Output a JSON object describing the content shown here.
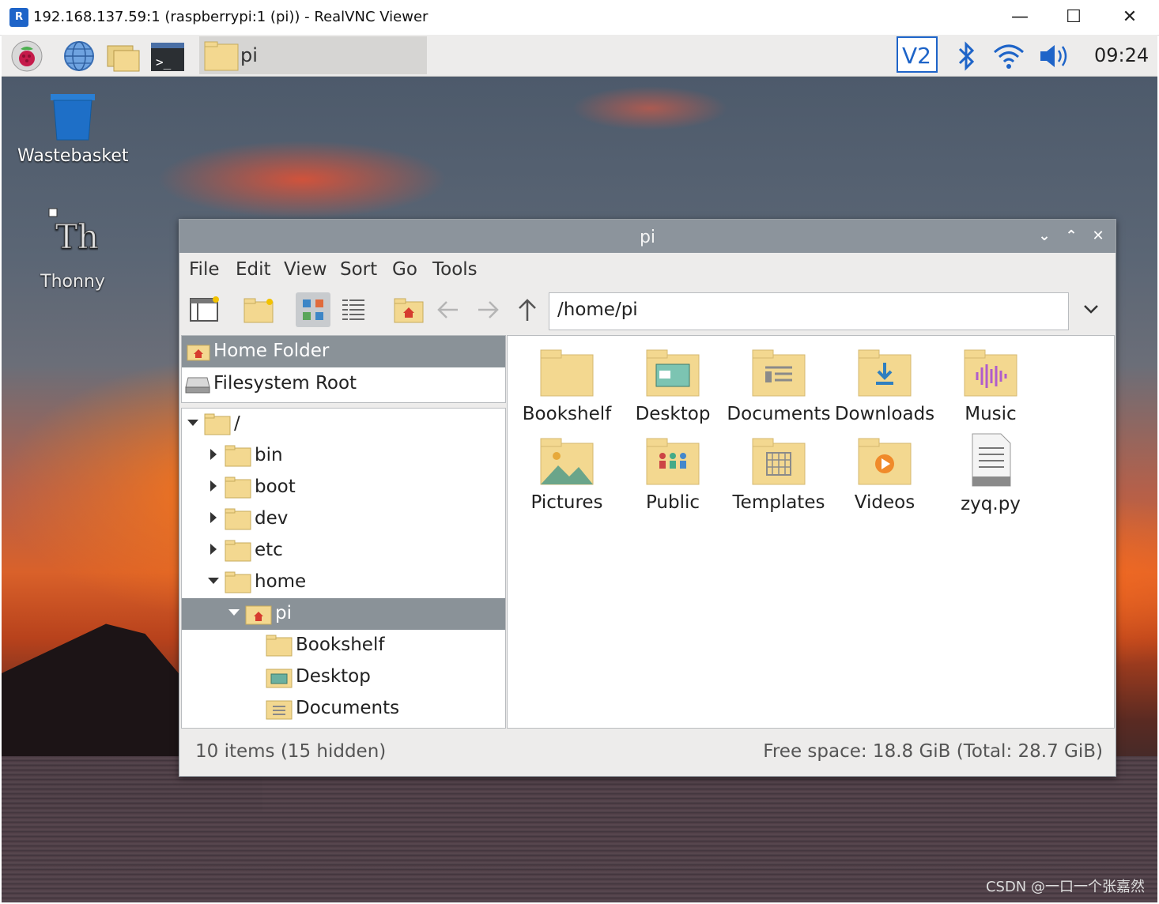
{
  "host_window": {
    "title": "192.168.137.59:1 (raspberrypi:1 (pi)) - RealVNC Viewer",
    "logo_text": "R",
    "minimize": "—",
    "maximize": "☐",
    "close": "✕"
  },
  "taskbar": {
    "active_task_label": "pi",
    "clock": "09:24",
    "tray_icons": [
      "vnc-icon",
      "bluetooth-icon",
      "wifi-icon",
      "volume-icon"
    ]
  },
  "desktop": {
    "icons": [
      {
        "label": "Wastebasket",
        "icon": "trash-icon"
      },
      {
        "label": "Thonny",
        "icon": "thonny-icon"
      }
    ],
    "watermark": "CSDN @一口一个张嘉然"
  },
  "file_manager": {
    "title": "pi",
    "controls": {
      "minimize": "⌄",
      "maximize": "⌃",
      "close": "✕"
    },
    "menu": [
      "File",
      "Edit",
      "View",
      "Sort",
      "Go",
      "Tools"
    ],
    "path": "/home/pi",
    "places": [
      {
        "label": "Home Folder",
        "selected": true
      },
      {
        "label": "Filesystem Root",
        "selected": false
      }
    ],
    "tree": [
      {
        "label": "/",
        "level": 0,
        "expanded": true
      },
      {
        "label": "bin",
        "level": 1,
        "expanded": false
      },
      {
        "label": "boot",
        "level": 1,
        "expanded": false
      },
      {
        "label": "dev",
        "level": 1,
        "expanded": false
      },
      {
        "label": "etc",
        "level": 1,
        "expanded": false
      },
      {
        "label": "home",
        "level": 1,
        "expanded": true
      },
      {
        "label": "pi",
        "level": 2,
        "expanded": true,
        "selected": true
      },
      {
        "label": "Bookshelf",
        "level": 3
      },
      {
        "label": "Desktop",
        "level": 3
      },
      {
        "label": "Documents",
        "level": 3
      }
    ],
    "items": [
      {
        "label": "Bookshelf",
        "icon": "folder-icon"
      },
      {
        "label": "Desktop",
        "icon": "desktop-folder-icon"
      },
      {
        "label": "Documents",
        "icon": "documents-folder-icon"
      },
      {
        "label": "Downloads",
        "icon": "downloads-folder-icon"
      },
      {
        "label": "Music",
        "icon": "music-folder-icon"
      },
      {
        "label": "Pictures",
        "icon": "pictures-folder-icon"
      },
      {
        "label": "Public",
        "icon": "public-folder-icon"
      },
      {
        "label": "Templates",
        "icon": "templates-folder-icon"
      },
      {
        "label": "Videos",
        "icon": "videos-folder-icon"
      },
      {
        "label": "zyq.py",
        "icon": "text-file-icon"
      }
    ],
    "status_left": "10 items (15 hidden)",
    "status_right": "Free space: 18.8 GiB (Total: 28.7 GiB)"
  },
  "colors": {
    "folder": "#f3d890",
    "selection": "#8a9298",
    "titlebar": "#8c949c"
  }
}
